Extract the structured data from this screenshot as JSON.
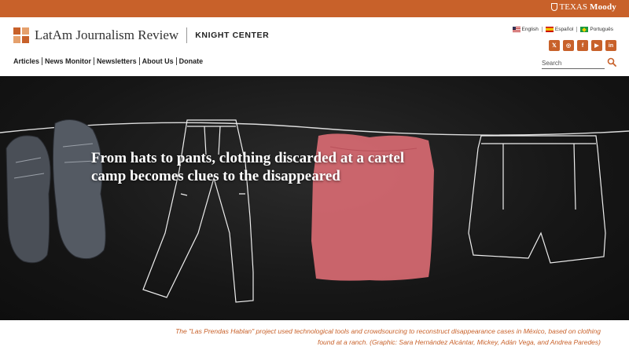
{
  "colors": {
    "accent": "#c8612a",
    "hero_bg": "#161616",
    "shirt": "#d86a72"
  },
  "topbar": {
    "brand_prefix": "TEXAS",
    "brand_name": "Moody",
    "icon": "longhorn-shield-icon"
  },
  "header": {
    "site_name": "LatAm Journalism Review",
    "partner": "KNIGHT CENTER",
    "languages": [
      {
        "label": "English",
        "icon": "us-flag-icon"
      },
      {
        "label": "Español",
        "icon": "spain-flag-icon"
      },
      {
        "label": "Português",
        "icon": "brazil-flag-icon"
      }
    ],
    "social": [
      {
        "glyph": "𝕏",
        "icon": "x-icon"
      },
      {
        "glyph": "◎",
        "icon": "instagram-icon"
      },
      {
        "glyph": "f",
        "icon": "facebook-icon"
      },
      {
        "glyph": "▶",
        "icon": "youtube-icon"
      },
      {
        "glyph": "in",
        "icon": "linkedin-icon"
      }
    ],
    "search_placeholder": "Search"
  },
  "nav": {
    "items": [
      "Articles",
      "News Monitor",
      "Newsletters",
      "About Us",
      "Donate"
    ]
  },
  "hero": {
    "headline": "From hats to pants, clothing discarded at a cartel camp becomes clues to the disappeared",
    "caption": "The \"Las Prendas Hablan\" project used technological tools and crowdsourcing to reconstruct disappearance cases in México, based on clothing found at a ranch. (Graphic: Sara Hernández Alcántar, Mickey, Adán Vega, and Andrea Paredes)"
  }
}
